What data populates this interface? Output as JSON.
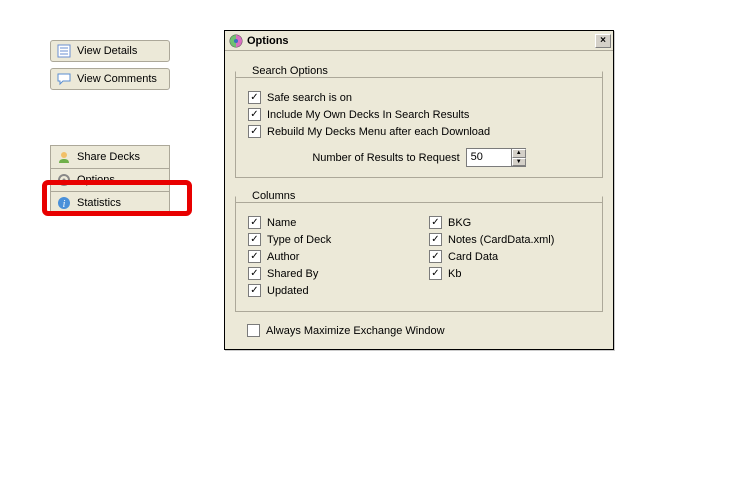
{
  "sidebar": {
    "btn1": "View Details",
    "btn2": "View Comments",
    "row1": "Share Decks",
    "row2": "Options",
    "row3": "Statistics"
  },
  "dialog": {
    "title": "Options",
    "group1": {
      "legend": "Search Options",
      "opt1": "Safe search is on",
      "opt2": "Include My Own Decks In Search Results",
      "opt3": "Rebuild My Decks Menu after each Download",
      "num_label": "Number of Results to Request",
      "num_value": "50"
    },
    "group2": {
      "legend": "Columns",
      "left": [
        "Name",
        "Type of Deck",
        "Author",
        "Shared By",
        "Updated"
      ],
      "right": [
        "BKG",
        "Notes (CardData.xml)",
        "Card Data",
        "Kb"
      ]
    },
    "always_max": "Always Maximize Exchange Window"
  }
}
